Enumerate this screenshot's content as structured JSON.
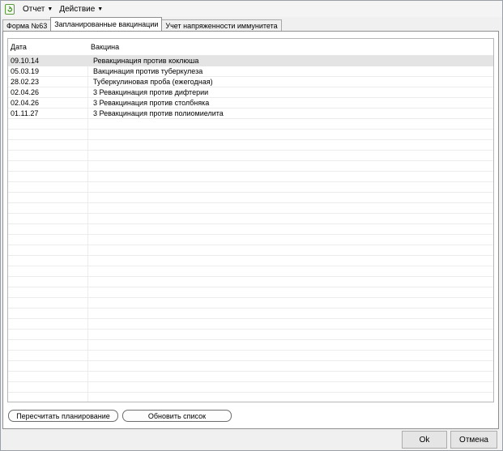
{
  "menu": {
    "report_label": "Отчет",
    "action_label": "Действие"
  },
  "tabs": [
    {
      "label": "Форма №63",
      "active": false
    },
    {
      "label": "Запланированные вакцинации",
      "active": true
    },
    {
      "label": "Учет напряженности иммунитета",
      "active": false
    }
  ],
  "grid": {
    "columns": {
      "date": "Дата",
      "vaccine": "Вакцина"
    },
    "rows": [
      {
        "date": "09.10.14",
        "vaccine": "Ревакцинация против коклюша"
      },
      {
        "date": "05.03.19",
        "vaccine": "Вакцинация против туберкулеза"
      },
      {
        "date": "28.02.23",
        "vaccine": "Туберкулиновая проба (ежегодная)"
      },
      {
        "date": "02.04.26",
        "vaccine": "3 Ревакцинация против дифтерии"
      },
      {
        "date": "02.04.26",
        "vaccine": "3 Ревакцинация против столбняка"
      },
      {
        "date": "01.11.27",
        "vaccine": "3 Ревакцинация против полиомиелита"
      }
    ]
  },
  "panel_buttons": {
    "recalc_label": "Пересчитать планирование",
    "refresh_label": "Обновить список"
  },
  "dialog_buttons": {
    "ok_label": "Ok",
    "cancel_label": "Отмена"
  },
  "icons": {
    "app": "refresh-document-icon",
    "menu_caret": "caret-down-icon"
  }
}
